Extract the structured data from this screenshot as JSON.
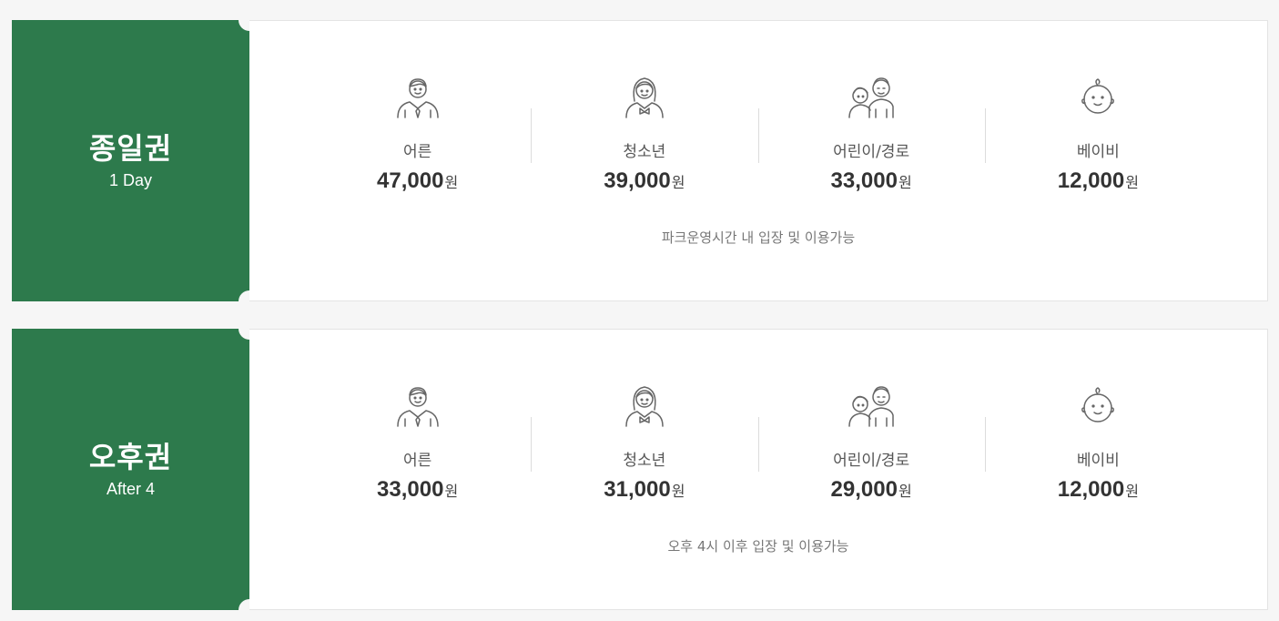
{
  "tickets": [
    {
      "name": "종일권",
      "sub": "1 Day",
      "note": "파크운영시간 내 입장 및 이용가능",
      "prices": [
        {
          "icon": "adult-man-icon",
          "label": "어른",
          "amount": "47,000",
          "unit": "원"
        },
        {
          "icon": "teen-girl-icon",
          "label": "청소년",
          "amount": "39,000",
          "unit": "원"
        },
        {
          "icon": "child-elderly-icon",
          "label": "어린이/경로",
          "amount": "33,000",
          "unit": "원"
        },
        {
          "icon": "baby-icon",
          "label": "베이비",
          "amount": "12,000",
          "unit": "원"
        }
      ]
    },
    {
      "name": "오후권",
      "sub": "After 4",
      "note": "오후 4시 이후 입장 및 이용가능",
      "prices": [
        {
          "icon": "adult-man-icon",
          "label": "어른",
          "amount": "33,000",
          "unit": "원"
        },
        {
          "icon": "teen-girl-icon",
          "label": "청소년",
          "amount": "31,000",
          "unit": "원"
        },
        {
          "icon": "child-elderly-icon",
          "label": "어린이/경로",
          "amount": "29,000",
          "unit": "원"
        },
        {
          "icon": "baby-icon",
          "label": "베이비",
          "amount": "12,000",
          "unit": "원"
        }
      ]
    }
  ],
  "colors": {
    "accent": "#2d7a4c",
    "background": "#f6f6f6",
    "text": "#333333"
  }
}
